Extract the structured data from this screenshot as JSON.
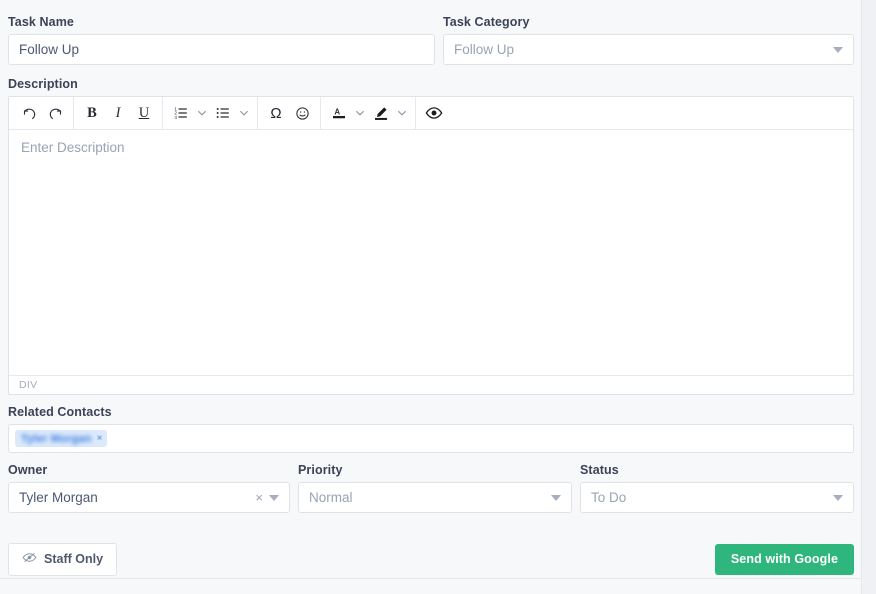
{
  "form": {
    "task_name": {
      "label": "Task Name",
      "value": "Follow Up"
    },
    "task_category": {
      "label": "Task Category",
      "value": "Follow Up"
    },
    "description": {
      "label": "Description",
      "placeholder": "Enter Description",
      "status_text": "DIV",
      "toolbar": {
        "undo": "undo-arrow",
        "redo": "redo-arrow",
        "bold": "B",
        "italic": "I",
        "underline": "U",
        "numbered_list": "numbered-list",
        "bulleted_list": "bulleted-list",
        "special_character": "Ω",
        "emoji": "emoji",
        "text_color": "A",
        "highlight_color": "highlighter",
        "preview": "eye"
      }
    },
    "related_contacts": {
      "label": "Related Contacts",
      "chips": [
        {
          "text": "Tyler Morgan",
          "remove": "×"
        }
      ]
    },
    "owner": {
      "label": "Owner",
      "value": "Tyler Morgan",
      "clear": "×"
    },
    "priority": {
      "label": "Priority",
      "value": "Normal"
    },
    "status": {
      "label": "Status",
      "value": "To Do"
    }
  },
  "footer": {
    "staff_only_label": "Staff Only",
    "send_label": "Send with Google"
  },
  "colors": {
    "accent_green": "#2fb67d",
    "chip_bg": "#dce9fb",
    "chip_text": "#3f7fe0",
    "label_text": "#3c4257",
    "field_border": "#dfe3e8"
  }
}
